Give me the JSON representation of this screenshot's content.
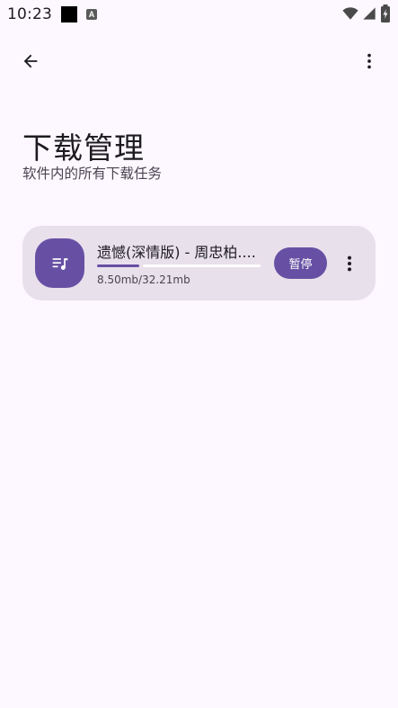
{
  "status_bar": {
    "time": "10:23",
    "icons": [
      "notification-square-icon",
      "a-icon",
      "wifi-icon",
      "cell-signal-icon",
      "battery-charging-icon"
    ]
  },
  "app_bar": {
    "back_icon": "arrow-back-icon",
    "menu_icon": "more-vert-icon"
  },
  "header": {
    "title": "下载管理",
    "subtitle": "软件内的所有下载任务"
  },
  "downloads": [
    {
      "icon": "queue-music-icon",
      "title": "遗憾(深情版) - 周忠柏....",
      "size": "8.50mb/32.21mb",
      "progress": 0.26,
      "action_label": "暂停",
      "menu_icon": "more-vert-icon"
    }
  ],
  "colors": {
    "background": "#FDF7FF",
    "card": "#E8E0EB",
    "primary": "#6750A4",
    "on_surface": "#1D1B20",
    "on_surface_variant": "#49454F"
  }
}
